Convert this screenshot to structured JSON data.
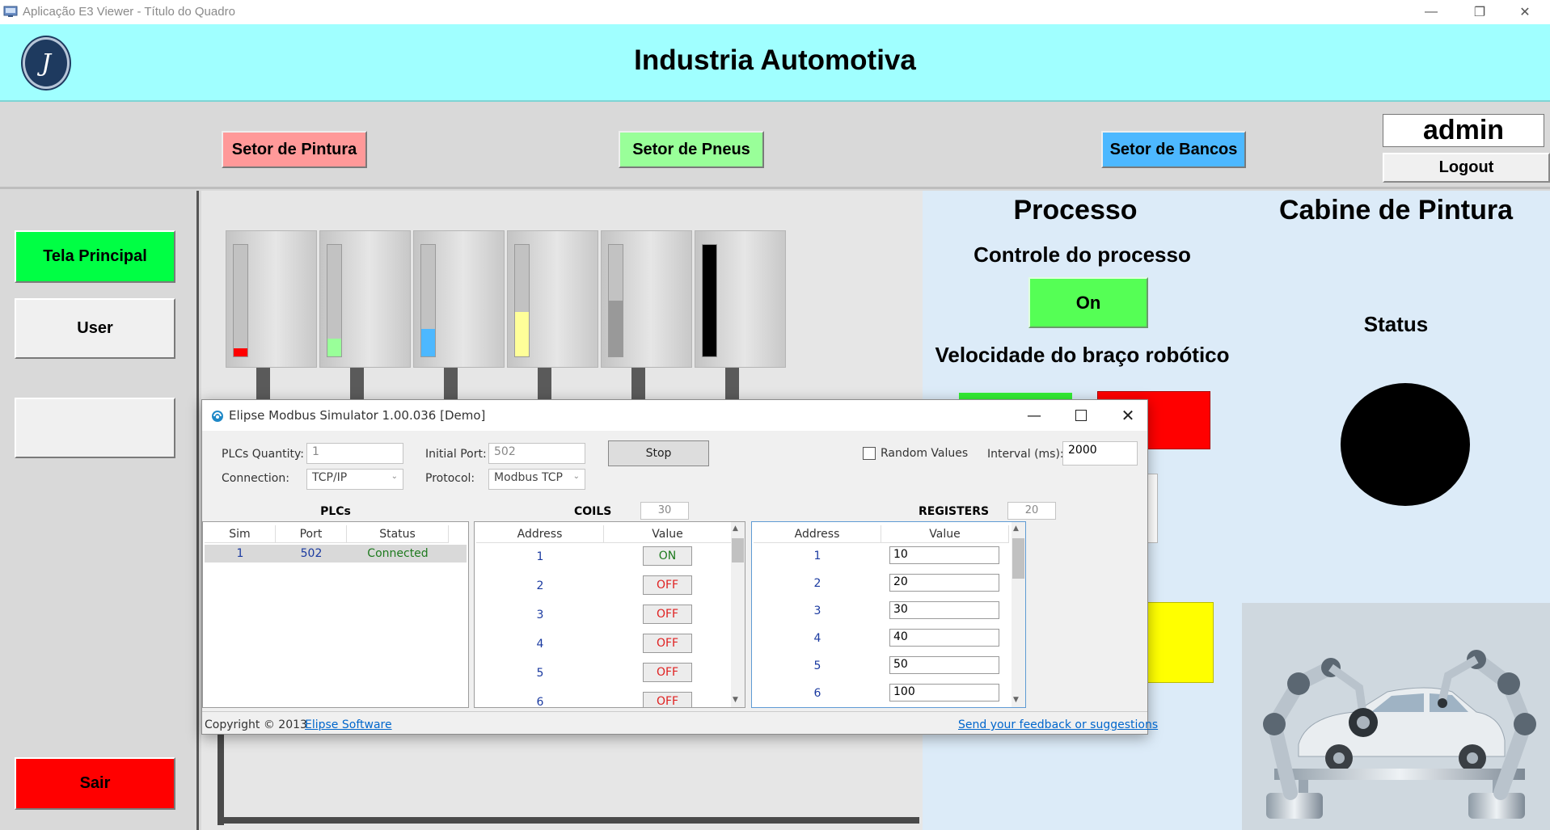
{
  "window": {
    "title": "Aplicação E3 Viewer - Título do Quadro"
  },
  "header": {
    "logo_letter": "J",
    "title": "Industria Automotiva"
  },
  "toolbar": {
    "sectors": [
      {
        "label": "Setor de Pintura",
        "color": "#ff9999"
      },
      {
        "label": "Setor de Pneus",
        "color": "#99ff99"
      },
      {
        "label": "Setor de Bancos",
        "color": "#4db8ff"
      }
    ],
    "user": "admin",
    "logout_label": "Logout"
  },
  "leftnav": {
    "items": [
      {
        "label": "Tela Principal",
        "color": "#00ff44"
      },
      {
        "label": "User",
        "color": "#f0f0f0"
      },
      {
        "label": "",
        "color": "#f0f0f0"
      }
    ],
    "exit_label": "Sair",
    "exit_color": "#ff0000"
  },
  "tanks": [
    {
      "color": "#ff0000",
      "level": 0.07
    },
    {
      "color": "#99ff99",
      "level": 0.16
    },
    {
      "color": "#4db8ff",
      "level": 0.25
    },
    {
      "color": "#ffff99",
      "level": 0.4
    },
    {
      "color": "#999999",
      "level": 0.5
    },
    {
      "color": "#000000",
      "level": 1.0
    }
  ],
  "processo": {
    "title": "Processo",
    "control_label": "Controle do processo",
    "on_label": "On",
    "on_color": "#55ff55",
    "speed_label": "Velocidade do braço robótico"
  },
  "cabine": {
    "title": "Cabine de Pintura",
    "status_label": "Status",
    "status_color": "#000000"
  },
  "simulator": {
    "title": "Elipse Modbus Simulator 1.00.036 [Demo]",
    "plcs_quantity_label": "PLCs Quantity:",
    "plcs_quantity_value": "1",
    "initial_port_label": "Initial Port:",
    "initial_port_value": "502",
    "stop_label": "Stop",
    "random_values_label": "Random Values",
    "interval_label": "Interval (ms):",
    "interval_value": "2000",
    "connection_label": "Connection:",
    "connection_value": "TCP/IP",
    "protocol_label": "Protocol:",
    "protocol_value": "Modbus TCP",
    "plcs": {
      "heading": "PLCs",
      "columns": [
        "Sim",
        "Port",
        "Status"
      ],
      "rows": [
        {
          "sim": "1",
          "port": "502",
          "status": "Connected"
        }
      ]
    },
    "coils": {
      "heading": "COILS",
      "count": "30",
      "columns": [
        "Address",
        "Value"
      ],
      "rows": [
        {
          "address": "1",
          "value": "ON"
        },
        {
          "address": "2",
          "value": "OFF"
        },
        {
          "address": "3",
          "value": "OFF"
        },
        {
          "address": "4",
          "value": "OFF"
        },
        {
          "address": "5",
          "value": "OFF"
        },
        {
          "address": "6",
          "value": "OFF"
        }
      ]
    },
    "registers": {
      "heading": "REGISTERS",
      "count": "20",
      "columns": [
        "Address",
        "Value"
      ],
      "rows": [
        {
          "address": "1",
          "value": "10"
        },
        {
          "address": "2",
          "value": "20"
        },
        {
          "address": "3",
          "value": "30"
        },
        {
          "address": "4",
          "value": "40"
        },
        {
          "address": "5",
          "value": "50"
        },
        {
          "address": "6",
          "value": "100"
        }
      ]
    },
    "copyright": "Copyright © 2013",
    "copyright_link": "Elipse Software",
    "feedback_link": "Send your feedback or suggestions"
  }
}
